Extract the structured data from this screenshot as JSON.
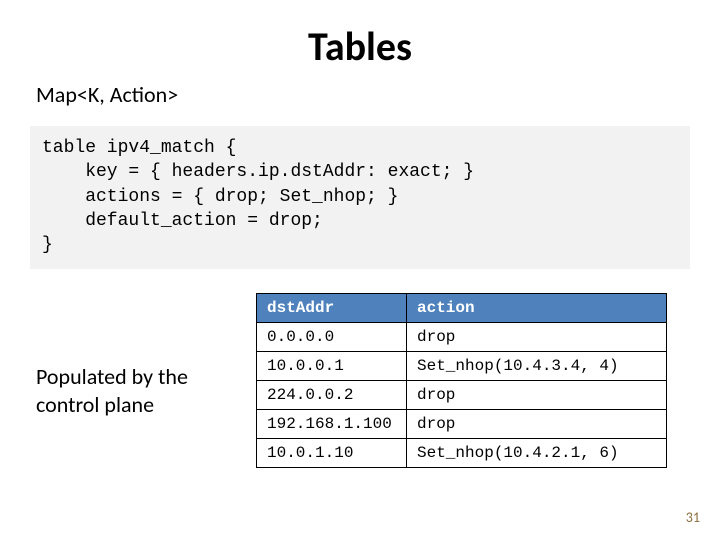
{
  "title": "Tables",
  "subtitle": "Map<K, Action>",
  "code": "table ipv4_match {\n    key = { headers.ip.dstAddr: exact; }\n    actions = { drop; Set_nhop; }\n    default_action = drop;\n}",
  "caption": "Populated by the control plane",
  "table": {
    "headers": [
      "dstAddr",
      "action"
    ],
    "rows": [
      [
        "0.0.0.0",
        "drop"
      ],
      [
        "10.0.0.1",
        "Set_nhop(10.4.3.4, 4)"
      ],
      [
        "224.0.0.2",
        "drop"
      ],
      [
        "192.168.1.100",
        "drop"
      ],
      [
        "10.0.1.10",
        "Set_nhop(10.4.2.1, 6)"
      ]
    ]
  },
  "page_number": "31"
}
